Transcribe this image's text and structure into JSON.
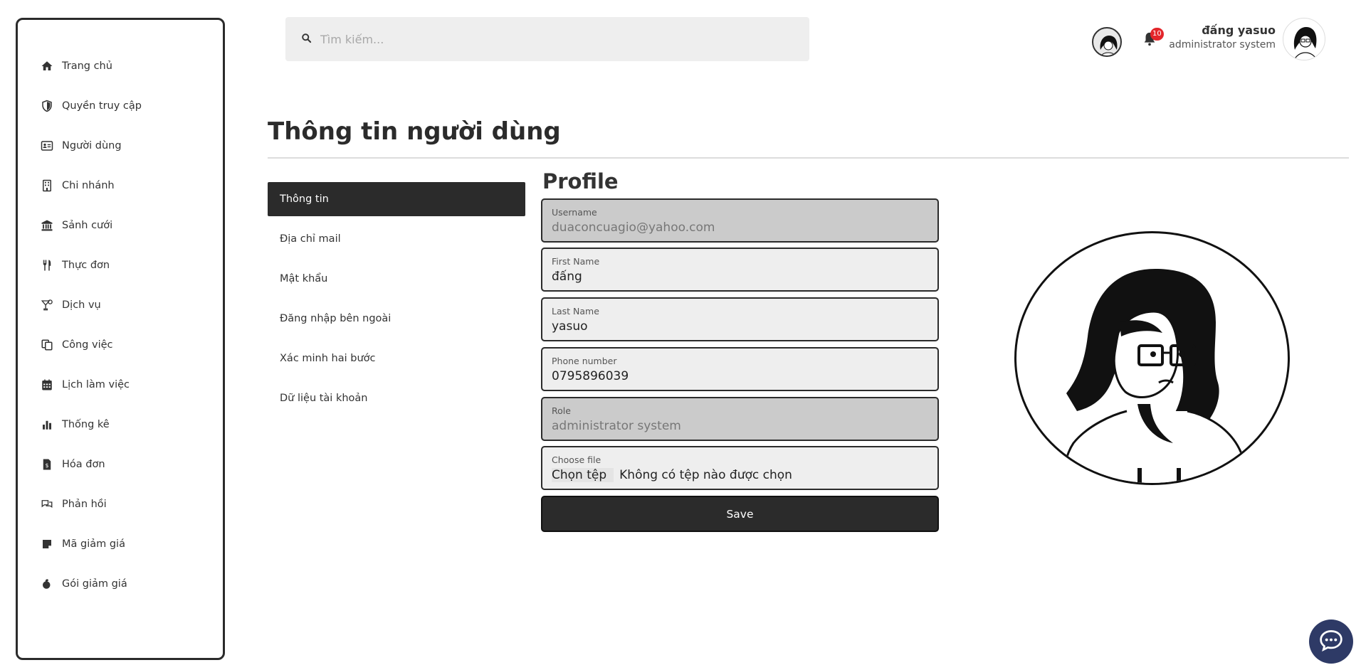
{
  "search": {
    "placeholder": "Tìm kiếm..."
  },
  "header": {
    "notifications_count": "10",
    "user_name": "đấng yasuo",
    "user_role": "administrator system"
  },
  "sidebar": {
    "items": [
      {
        "label": "Trang chủ",
        "icon": "home-icon"
      },
      {
        "label": "Quyền truy cập",
        "icon": "shield-icon"
      },
      {
        "label": "Người dùng",
        "icon": "id-card-icon"
      },
      {
        "label": "Chi nhánh",
        "icon": "building-icon"
      },
      {
        "label": "Sảnh cưới",
        "icon": "bank-icon"
      },
      {
        "label": "Thực đơn",
        "icon": "utensils-icon"
      },
      {
        "label": "Dịch vụ",
        "icon": "cocktail-icon"
      },
      {
        "label": "Công việc",
        "icon": "copy-icon"
      },
      {
        "label": "Lịch làm việc",
        "icon": "calendar-icon"
      },
      {
        "label": "Thống kê",
        "icon": "chart-icon"
      },
      {
        "label": "Hóa đơn",
        "icon": "invoice-icon"
      },
      {
        "label": "Phản hồi",
        "icon": "comments-icon"
      },
      {
        "label": "Mã giảm giá",
        "icon": "note-icon"
      },
      {
        "label": "Gói giảm giá",
        "icon": "bag-icon"
      }
    ]
  },
  "page": {
    "title": "Thông tin người dùng",
    "tabs": [
      {
        "label": "Thông tin",
        "active": true
      },
      {
        "label": "Địa chỉ mail",
        "active": false
      },
      {
        "label": "Mật khẩu",
        "active": false
      },
      {
        "label": "Đăng nhập bên ngoài",
        "active": false
      },
      {
        "label": "Xác minh hai bước",
        "active": false
      },
      {
        "label": "Dữ liệu tài khoản",
        "active": false
      }
    ]
  },
  "form": {
    "heading": "Profile",
    "username": {
      "label": "Username",
      "value": "duaconcuagio@yahoo.com"
    },
    "first_name": {
      "label": "First Name",
      "value": "đấng"
    },
    "last_name": {
      "label": "Last Name",
      "value": "yasuo"
    },
    "phone": {
      "label": "Phone number",
      "value": "0795896039"
    },
    "role": {
      "label": "Role",
      "value": "administrator system"
    },
    "file": {
      "label": "Choose file",
      "button": "Chọn tệp",
      "status": "Không có tệp nào được chọn"
    },
    "save_label": "Save"
  },
  "colors": {
    "primary": "#2b2b2b",
    "badge": "#e3262b",
    "chat": "#2e3a66",
    "field_bg": "#eeeeee",
    "disabled_bg": "#cbcbcb"
  }
}
